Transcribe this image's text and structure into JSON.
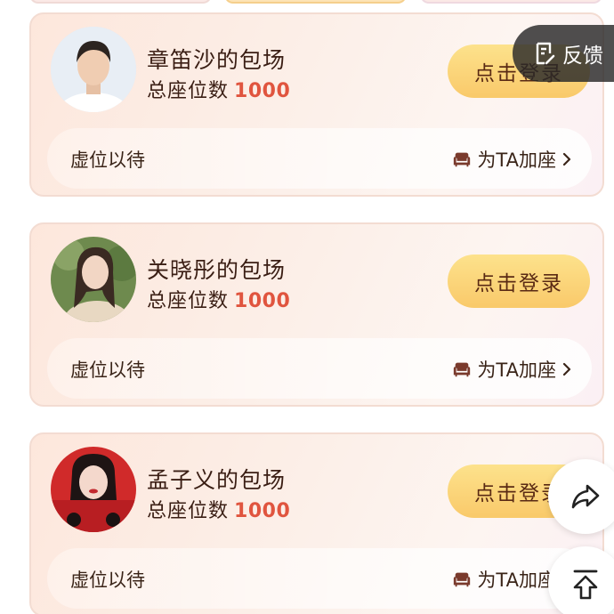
{
  "cards": [
    {
      "title": "章笛沙的包场",
      "seats_label": "总座位数",
      "seats_value": "1000",
      "login_label": "点击登录",
      "placeholder": "虚位以待",
      "add_seat_label": "为TA加座"
    },
    {
      "title": "关晓彤的包场",
      "seats_label": "总座位数",
      "seats_value": "1000",
      "login_label": "点击登录",
      "placeholder": "虚位以待",
      "add_seat_label": "为TA加座"
    },
    {
      "title": "孟子义的包场",
      "seats_label": "总座位数",
      "seats_value": "1000",
      "login_label": "点击登录",
      "placeholder": "虚位以待",
      "add_seat_label": "为TA加座"
    }
  ],
  "feedback": {
    "label": "反馈",
    "icon": "feedback-icon"
  },
  "floating": {
    "share_icon": "share-icon",
    "top_icon": "back-to-top-icon"
  },
  "colors": {
    "accent": "#e0553f",
    "button": "#f9c96a",
    "text": "#3a1e14"
  }
}
